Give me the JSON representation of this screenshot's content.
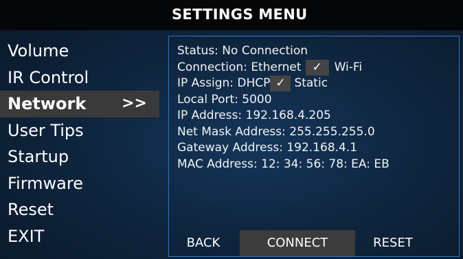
{
  "header": {
    "title": "SETTINGS MENU"
  },
  "menu": {
    "items": [
      {
        "label": "Volume",
        "active": false
      },
      {
        "label": "IR Control",
        "active": false
      },
      {
        "label": "Network",
        "active": true
      },
      {
        "label": "User Tips",
        "active": false
      },
      {
        "label": "Startup",
        "active": false
      },
      {
        "label": "Firmware",
        "active": false
      },
      {
        "label": "Reset",
        "active": false
      },
      {
        "label": "EXIT",
        "active": false
      }
    ],
    "active_marker": ">>"
  },
  "network": {
    "status": "Status: No Connection",
    "connection_label": "Connection: Ethernet",
    "connection_check": "✓",
    "connection_option2": "Wi-Fi",
    "ip_assign_label": "IP Assign: DHCP",
    "ip_assign_check": "✓",
    "ip_assign_option2": "Static",
    "local_port": "Local Port: 5000",
    "ip_address": "IP Address: 192.168.4.205",
    "net_mask": "Net Mask Address: 255.255.255.0",
    "gateway": "Gateway Address: 192.168.4.1",
    "mac": "MAC Address: 12: 34: 56: 78: EA: EB"
  },
  "buttons": {
    "back": "BACK",
    "connect": "CONNECT",
    "reset": "RESET"
  },
  "colors": {
    "background": "#0f2640",
    "title_bar": "#050607",
    "highlight": "#3a3a3a",
    "panel_border": "#2d78c4"
  }
}
